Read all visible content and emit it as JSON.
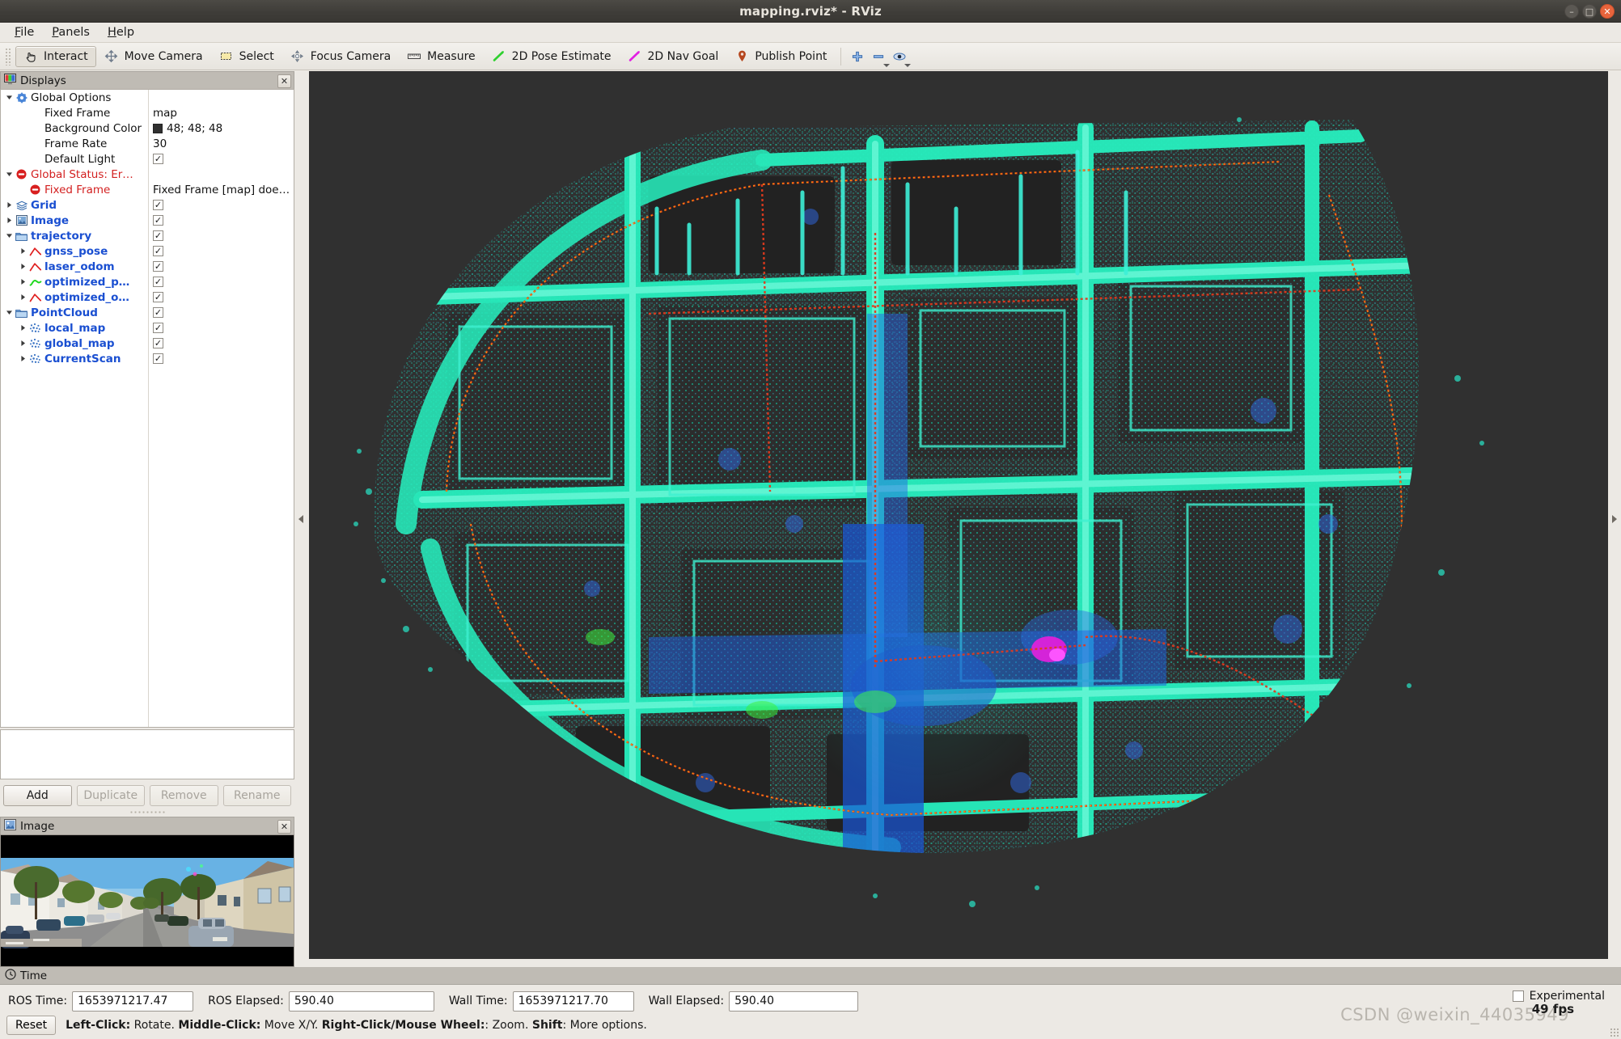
{
  "window": {
    "title": "mapping.rviz* - RViz",
    "buttons": {
      "minimize": "–",
      "maximize": "□",
      "close": "✕"
    }
  },
  "menubar": {
    "items": [
      "File",
      "Panels",
      "Help"
    ]
  },
  "toolbar": {
    "items": [
      {
        "label": "Interact",
        "icon": "hand-cursor-icon",
        "active": true
      },
      {
        "label": "Move Camera",
        "icon": "move-camera-icon",
        "active": false
      },
      {
        "label": "Select",
        "icon": "select-rect-icon",
        "active": false
      },
      {
        "label": "Focus Camera",
        "icon": "focus-camera-icon",
        "active": false
      },
      {
        "label": "Measure",
        "icon": "ruler-icon",
        "active": false
      },
      {
        "label": "2D Pose Estimate",
        "icon": "green-arrow-icon",
        "active": false
      },
      {
        "label": "2D Nav Goal",
        "icon": "magenta-arrow-icon",
        "active": false
      },
      {
        "label": "Publish Point",
        "icon": "map-pin-icon",
        "active": false
      }
    ],
    "extra_icons": [
      "plus-icon",
      "minus-icon",
      "eye-icon"
    ]
  },
  "displays": {
    "panel_title": "Displays",
    "close_label": "✕",
    "tree": [
      {
        "indent": 0,
        "arrow": "down",
        "icon": "gear-icon",
        "label": "Global Options",
        "style": "plain",
        "value_type": "none"
      },
      {
        "indent": 1,
        "arrow": "none",
        "icon": "none",
        "label": "Fixed Frame",
        "style": "plain",
        "value_type": "text",
        "value": "map"
      },
      {
        "indent": 1,
        "arrow": "none",
        "icon": "none",
        "label": "Background Color",
        "style": "plain",
        "value_type": "color",
        "value": "48; 48; 48",
        "color": "#303030"
      },
      {
        "indent": 1,
        "arrow": "none",
        "icon": "none",
        "label": "Frame Rate",
        "style": "plain",
        "value_type": "text",
        "value": "30"
      },
      {
        "indent": 1,
        "arrow": "none",
        "icon": "none",
        "label": "Default Light",
        "style": "plain",
        "value_type": "check",
        "value": "✓"
      },
      {
        "indent": 0,
        "arrow": "down",
        "icon": "error-icon",
        "label": "Global Status: Er…",
        "style": "red",
        "value_type": "none"
      },
      {
        "indent": 1,
        "arrow": "none",
        "icon": "error-icon",
        "label": "Fixed Frame",
        "style": "red",
        "value_type": "text",
        "value": "Fixed Frame [map] doe…"
      },
      {
        "indent": 0,
        "arrow": "right",
        "icon": "grid-icon",
        "label": "Grid",
        "style": "blue",
        "value_type": "check",
        "value": "✓"
      },
      {
        "indent": 0,
        "arrow": "right",
        "icon": "image-icon",
        "label": "Image",
        "style": "blue",
        "value_type": "check",
        "value": "✓"
      },
      {
        "indent": 0,
        "arrow": "down",
        "icon": "folder-icon",
        "label": "trajectory",
        "style": "blue",
        "value_type": "check",
        "value": "✓"
      },
      {
        "indent": 1,
        "arrow": "right",
        "icon": "path-red-icon",
        "label": "gnss_pose",
        "style": "blue",
        "value_type": "check",
        "value": "✓"
      },
      {
        "indent": 1,
        "arrow": "right",
        "icon": "path-red-icon",
        "label": "laser_odom",
        "style": "blue",
        "value_type": "check",
        "value": "✓"
      },
      {
        "indent": 1,
        "arrow": "right",
        "icon": "path-green-icon",
        "label": "optimized_p…",
        "style": "blue",
        "value_type": "check",
        "value": "✓"
      },
      {
        "indent": 1,
        "arrow": "right",
        "icon": "path-red-icon",
        "label": "optimized_o…",
        "style": "blue",
        "value_type": "check",
        "value": "✓"
      },
      {
        "indent": 0,
        "arrow": "down",
        "icon": "folder-icon",
        "label": "PointCloud",
        "style": "blue",
        "value_type": "check",
        "value": "✓"
      },
      {
        "indent": 1,
        "arrow": "right",
        "icon": "pointcloud-icon",
        "label": "local_map",
        "style": "blue",
        "value_type": "check",
        "value": "✓"
      },
      {
        "indent": 1,
        "arrow": "right",
        "icon": "pointcloud-icon",
        "label": "global_map",
        "style": "blue",
        "value_type": "check",
        "value": "✓"
      },
      {
        "indent": 1,
        "arrow": "right",
        "icon": "pointcloud-icon",
        "label": "CurrentScan",
        "style": "blue",
        "value_type": "check",
        "value": "✓"
      }
    ],
    "buttons": [
      {
        "label": "Add",
        "enabled": true
      },
      {
        "label": "Duplicate",
        "enabled": false
      },
      {
        "label": "Remove",
        "enabled": false
      },
      {
        "label": "Rename",
        "enabled": false
      }
    ]
  },
  "image_panel": {
    "panel_title": "Image",
    "close_label": "✕",
    "description": "front camera view of a residential street with parked cars, trees and houses"
  },
  "view3d": {
    "background_color": "#303030",
    "fps": "49 fps",
    "description": "aerial lidar point cloud map of a town, colored by height (cyan/green/blue) with red GNSS trajectory overlay"
  },
  "time": {
    "panel_title": "Time",
    "ros_time_label": "ROS Time:",
    "ros_time_value": "1653971217.47",
    "ros_elapsed_label": "ROS Elapsed:",
    "ros_elapsed_value": "590.40",
    "wall_time_label": "Wall Time:",
    "wall_time_value": "1653971217.70",
    "wall_elapsed_label": "Wall Elapsed:",
    "wall_elapsed_value": "590.40",
    "experimental_label": "Experimental",
    "reset_label": "Reset",
    "hint_segments": [
      {
        "text": "Left-Click:",
        "bold": true
      },
      {
        "text": " Rotate. ",
        "bold": false
      },
      {
        "text": "Middle-Click:",
        "bold": true
      },
      {
        "text": " Move X/Y. ",
        "bold": false
      },
      {
        "text": "Right-Click/Mouse Wheel:",
        "bold": true
      },
      {
        "text": ": Zoom. ",
        "bold": false
      },
      {
        "text": "Shift",
        "bold": true
      },
      {
        "text": ": More options.",
        "bold": false
      }
    ]
  },
  "watermark": {
    "text": "CSDN @weixin_44035949"
  }
}
